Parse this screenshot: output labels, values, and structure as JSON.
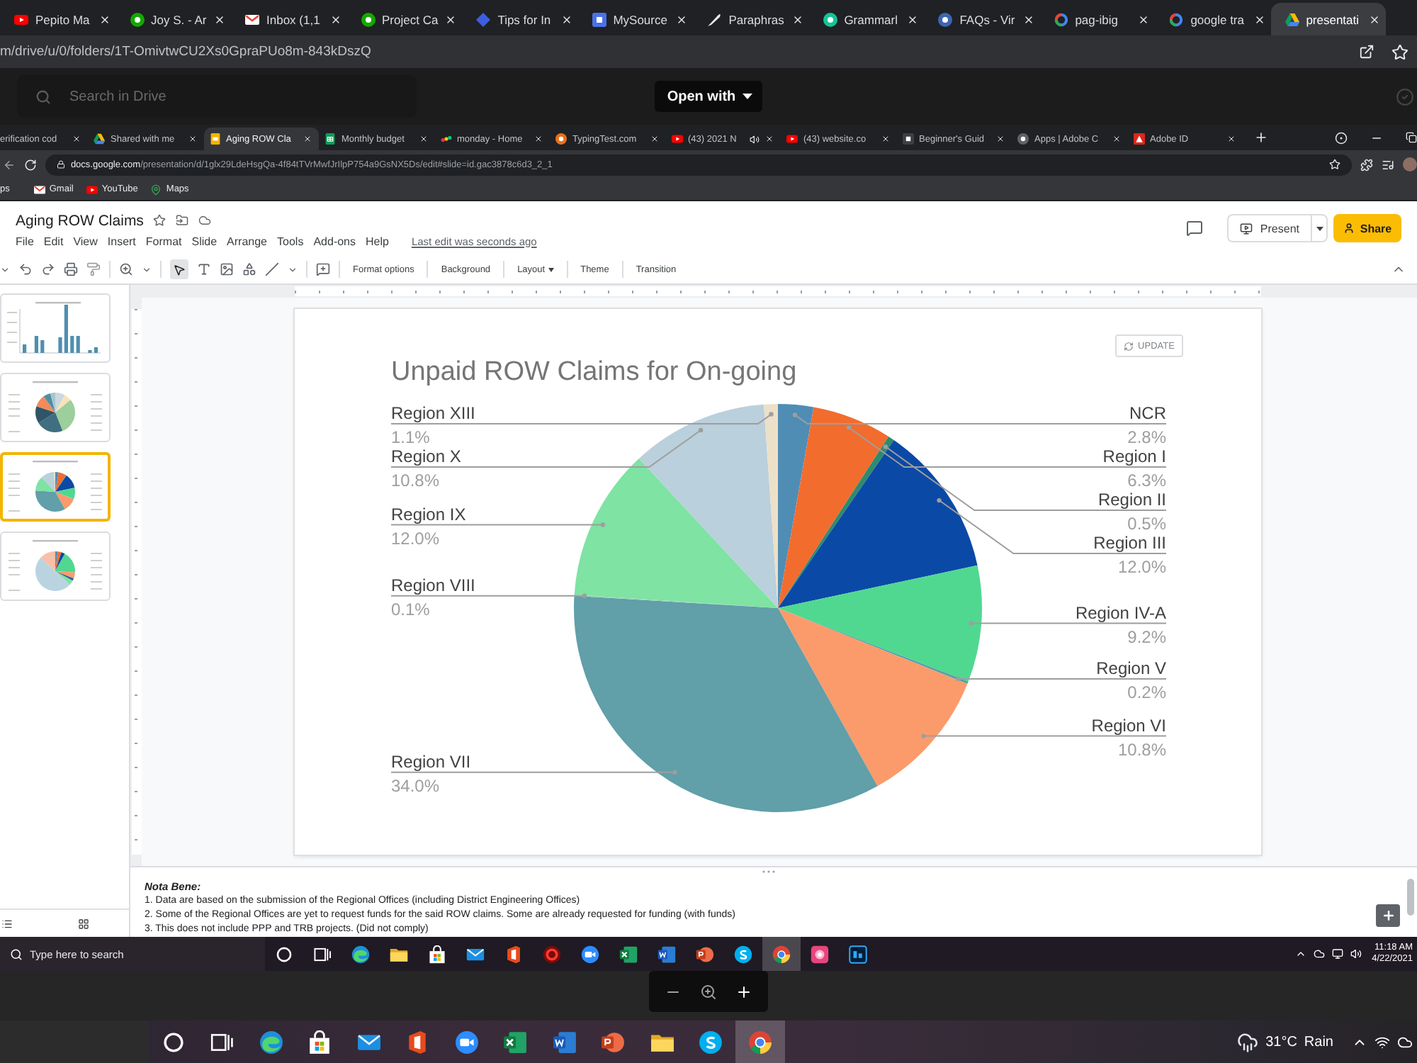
{
  "browser": {
    "tabs": [
      {
        "title": "Pepito Ma",
        "selected": false
      },
      {
        "title": "Joy S. - Ar",
        "selected": false
      },
      {
        "title": "Inbox (1,1",
        "selected": false
      },
      {
        "title": "Project Ca",
        "selected": false
      },
      {
        "title": "Tips for In",
        "selected": false
      },
      {
        "title": "MySource",
        "selected": false
      },
      {
        "title": "Paraphras",
        "selected": false
      },
      {
        "title": "Grammarl",
        "selected": false
      },
      {
        "title": "FAQs - Vir",
        "selected": false
      },
      {
        "title": "pag-ibig",
        "selected": false
      },
      {
        "title": "google tra",
        "selected": false
      },
      {
        "title": "presentati",
        "selected": true
      }
    ],
    "address": "m/drive/u/0/folders/1T-OmivtwCU2Xs0GpraPUo8m-843kDszQ"
  },
  "preview": {
    "search": {
      "placeholder": "Search in Drive"
    },
    "open_with": "Open with"
  },
  "screenshot": {
    "browser": {
      "tabs": [
        {
          "title": "erification cod",
          "selected": false,
          "playing": false
        },
        {
          "title": "Shared with me",
          "selected": false,
          "playing": false
        },
        {
          "title": "Aging ROW Cla",
          "selected": true,
          "playing": false
        },
        {
          "title": "Monthly budget",
          "selected": false,
          "playing": false
        },
        {
          "title": "monday - Home",
          "selected": false,
          "playing": false
        },
        {
          "title": "TypingTest.com",
          "selected": false,
          "playing": false
        },
        {
          "title": "(43) 2021 N",
          "selected": false,
          "playing": true
        },
        {
          "title": "(43) website.co",
          "selected": false,
          "playing": false
        },
        {
          "title": "Beginner's Guid",
          "selected": false,
          "playing": false
        },
        {
          "title": "Apps | Adobe C",
          "selected": false,
          "playing": false
        },
        {
          "title": "Adobe ID",
          "selected": false,
          "playing": false
        }
      ],
      "url_host": "docs.google.com",
      "url_path": "/presentation/d/1glx29LdeHsgQa-4f84tTVrMwfJrIlpP754a9GsNX5Ds/edit#slide=id.gac3878c6d3_2_1",
      "bookmarks": [
        "ps",
        "Gmail",
        "YouTube",
        "Maps"
      ]
    },
    "slides": {
      "title": "Aging ROW Claims",
      "menu": [
        "File",
        "Edit",
        "View",
        "Insert",
        "Format",
        "Slide",
        "Arrange",
        "Tools",
        "Add-ons",
        "Help"
      ],
      "last_edit": "Last edit was seconds ago",
      "present": "Present",
      "share": "Share",
      "pointer_tool": {
        "selected": true
      },
      "toolbar": [
        {
          "label": "Format options",
          "dropdown": false
        },
        {
          "label": "Background",
          "dropdown": false
        },
        {
          "label": "Layout",
          "dropdown": true
        },
        {
          "label": "Theme",
          "dropdown": false
        },
        {
          "label": "Transition",
          "dropdown": false
        }
      ],
      "filmstrip": [
        {
          "kind": "bar",
          "selected": false
        },
        {
          "kind": "pie",
          "selected": false
        },
        {
          "kind": "pie",
          "selected": true
        },
        {
          "kind": "pie",
          "selected": false
        }
      ],
      "slide": {
        "update_button": "UPDATE",
        "chart_data": {
          "type": "pie",
          "title": "Unpaid ROW Claims for On-going",
          "categories": [
            "NCR",
            "Region I",
            "Region II",
            "Region III",
            "Region IV-A",
            "Region V",
            "Region VI",
            "Region VII",
            "Region VIII",
            "Region IX",
            "Region X",
            "Region XIII"
          ],
          "values": [
            2.8,
            6.3,
            0.5,
            12.0,
            9.2,
            0.2,
            10.8,
            34.0,
            0.1,
            12.0,
            10.8,
            1.1
          ],
          "colors": [
            "#4f8db5",
            "#f26c2e",
            "#2e8b6e",
            "#0b49a6",
            "#50d890",
            "#56a0a8",
            "#fb9b6b",
            "#619fa9",
            "#8fd4b0",
            "#7ee3a3",
            "#bad0dc",
            "#ede0c8"
          ],
          "value_labels": [
            "2.8%",
            "6.3%",
            "0.5%",
            "12.0%",
            "9.2%",
            "0.2%",
            "10.8%",
            "34.0%",
            "0.1%",
            "12.0%",
            "10.8%",
            "1.1%"
          ]
        }
      },
      "notes": {
        "heading": "Nota Bene:",
        "lines": [
          "1. Data are based on the submission of the Regional Offices (including District Engineering Offices)",
          "2. Some of the Regional Offices are yet to request funds for the said ROW claims. Some are already requested for funding (with funds)",
          "3. This does not include PPP and TRB projects. (Did not comply)"
        ]
      }
    },
    "taskbar": {
      "placeholder": "Type here to search",
      "apps": [
        {
          "selected": false
        },
        {
          "selected": false
        },
        {
          "selected": false
        },
        {
          "selected": false
        },
        {
          "selected": false
        },
        {
          "selected": false
        },
        {
          "selected": false
        },
        {
          "selected": false
        },
        {
          "selected": false
        },
        {
          "selected": false
        },
        {
          "selected": false
        },
        {
          "selected": false
        },
        {
          "selected": false
        },
        {
          "selected": true
        },
        {
          "selected": false
        },
        {
          "selected": false
        }
      ],
      "time": "11:18 AM",
      "date": "4/22/2021"
    }
  },
  "taskbar": {
    "apps": [
      {
        "selected": false
      },
      {
        "selected": false
      },
      {
        "selected": false
      },
      {
        "selected": false
      },
      {
        "selected": false
      },
      {
        "selected": false
      },
      {
        "selected": false
      },
      {
        "selected": false
      },
      {
        "selected": false
      },
      {
        "selected": false
      },
      {
        "selected": false
      },
      {
        "selected": false
      },
      {
        "selected": true
      }
    ],
    "temperature": "31°C",
    "weather": "Rain"
  }
}
